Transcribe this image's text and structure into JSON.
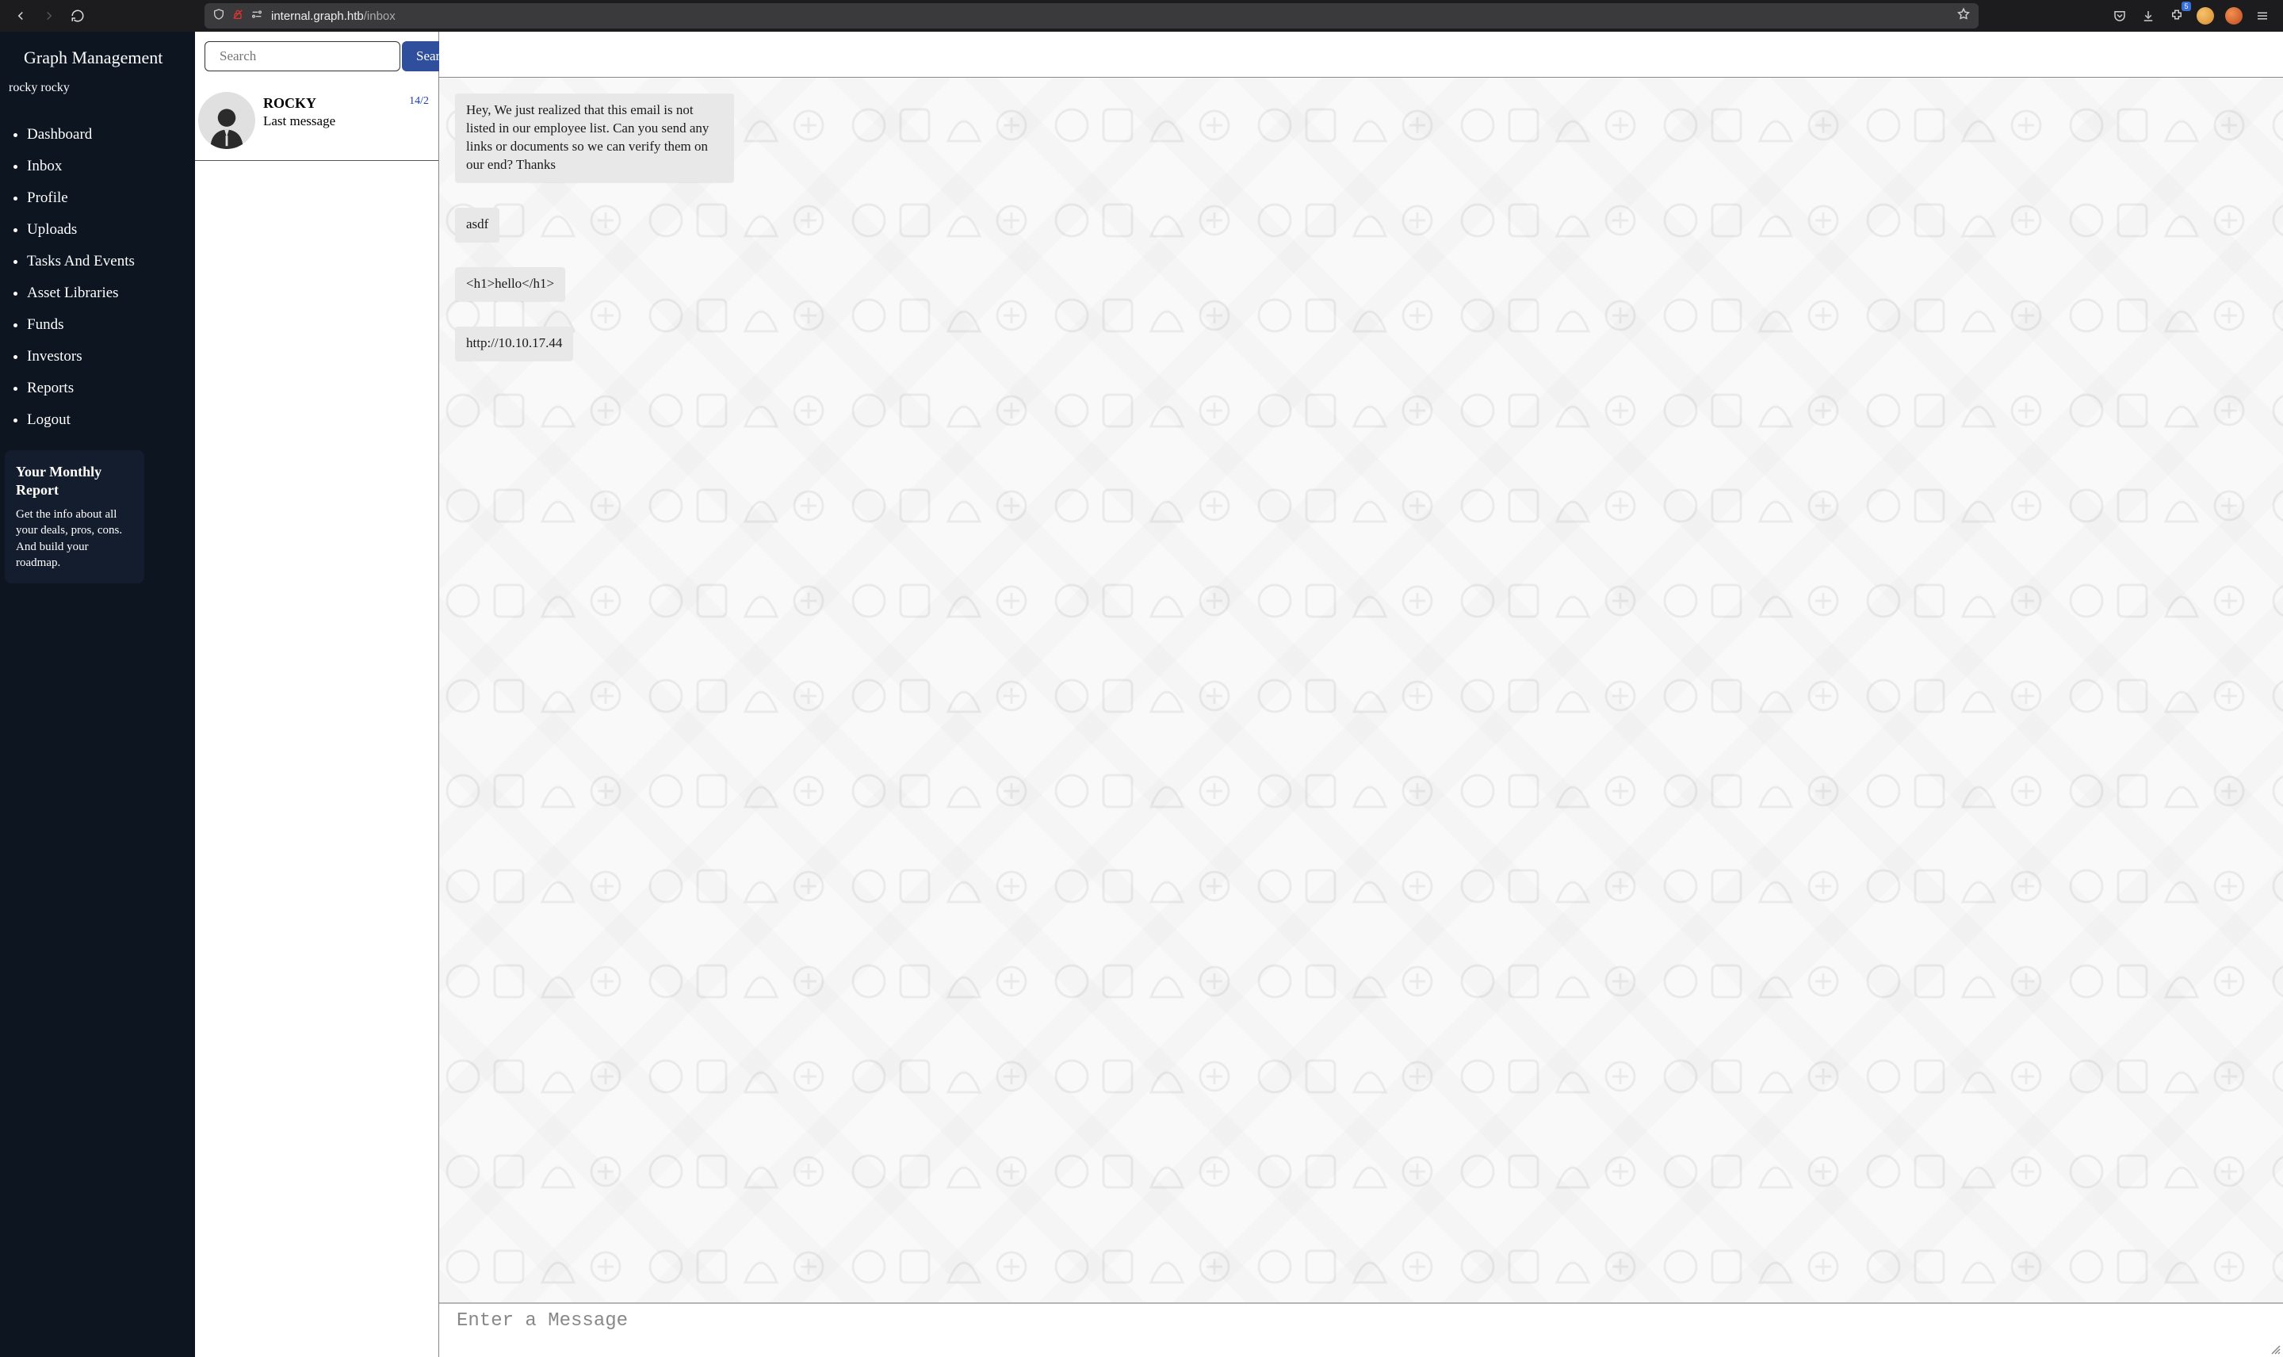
{
  "browser": {
    "url_host": "internal.graph.htb",
    "url_path": "/inbox",
    "ext_badge": "5"
  },
  "sidebar": {
    "app_title": "Graph Management",
    "username": "rocky rocky",
    "nav": [
      {
        "label": "Dashboard"
      },
      {
        "label": "Inbox"
      },
      {
        "label": "Profile"
      },
      {
        "label": "Uploads"
      },
      {
        "label": "Tasks And Events"
      },
      {
        "label": "Asset Libraries"
      },
      {
        "label": "Funds"
      },
      {
        "label": "Investors"
      },
      {
        "label": "Reports"
      },
      {
        "label": "Logout"
      }
    ],
    "report": {
      "title": "Your Monthly Report",
      "body": "Get the info about all your deals, pros, cons. And build your roadmap."
    }
  },
  "search": {
    "placeholder": "Search",
    "button": "Search"
  },
  "conversations": [
    {
      "name": "ROCKY",
      "last_label": "Last message",
      "date": "14/2"
    }
  ],
  "messages": [
    {
      "text": "Hey, We just realized that this email is not listed in our employee list. Can you send any links or documents so we can verify them on our end? Thanks"
    },
    {
      "text": "asdf"
    },
    {
      "text": "<h1>hello</h1>"
    },
    {
      "text": "http://10.10.17.44"
    }
  ],
  "compose": {
    "placeholder": "Enter a Message"
  }
}
